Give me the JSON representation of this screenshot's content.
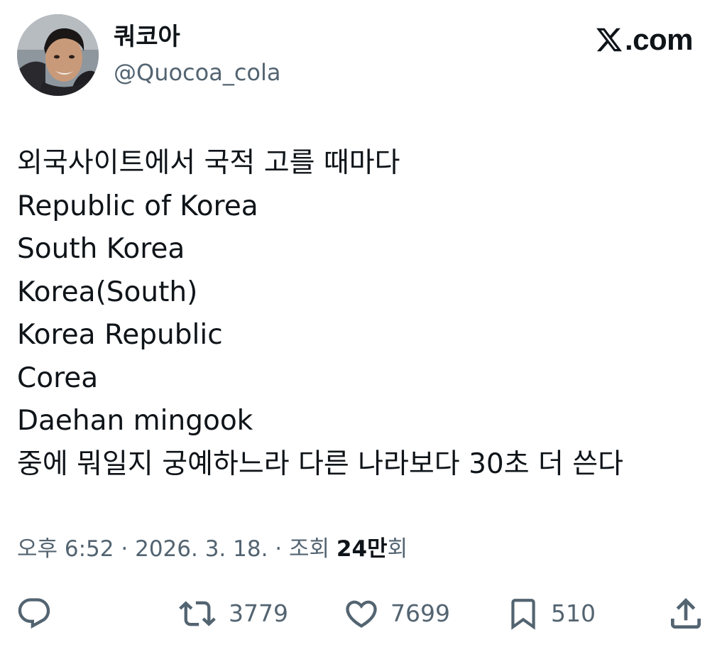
{
  "tweet": {
    "author": {
      "display_name": "쿼코아",
      "handle": "@Quocoa_cola"
    },
    "watermark": {
      "domain": ".com",
      "icon": "x-logo-icon"
    },
    "body_lines": [
      "외국사이트에서 국적 고를 때마다",
      "Republic of Korea",
      "South Korea",
      "Korea(South)",
      "Korea Republic",
      "Corea",
      "Daehan mingook",
      "중에 뭐일지 궁예하느라 다른 나라보다 30초 더 쓴다"
    ],
    "meta": {
      "time": "오후 6:52",
      "separator": "·",
      "date": "2026. 3. 18.",
      "views_prefix": "조회",
      "views_count": "24만",
      "views_suffix": "회"
    },
    "actions": {
      "reply": {
        "icon": "reply-icon"
      },
      "retweet": {
        "icon": "retweet-icon",
        "count": "3779"
      },
      "like": {
        "icon": "heart-icon",
        "count": "7699"
      },
      "bookmark": {
        "icon": "bookmark-icon",
        "count": "510"
      },
      "share": {
        "icon": "share-icon"
      }
    },
    "colors": {
      "text": "#0f1419",
      "muted": "#536471",
      "background": "#ffffff"
    }
  }
}
